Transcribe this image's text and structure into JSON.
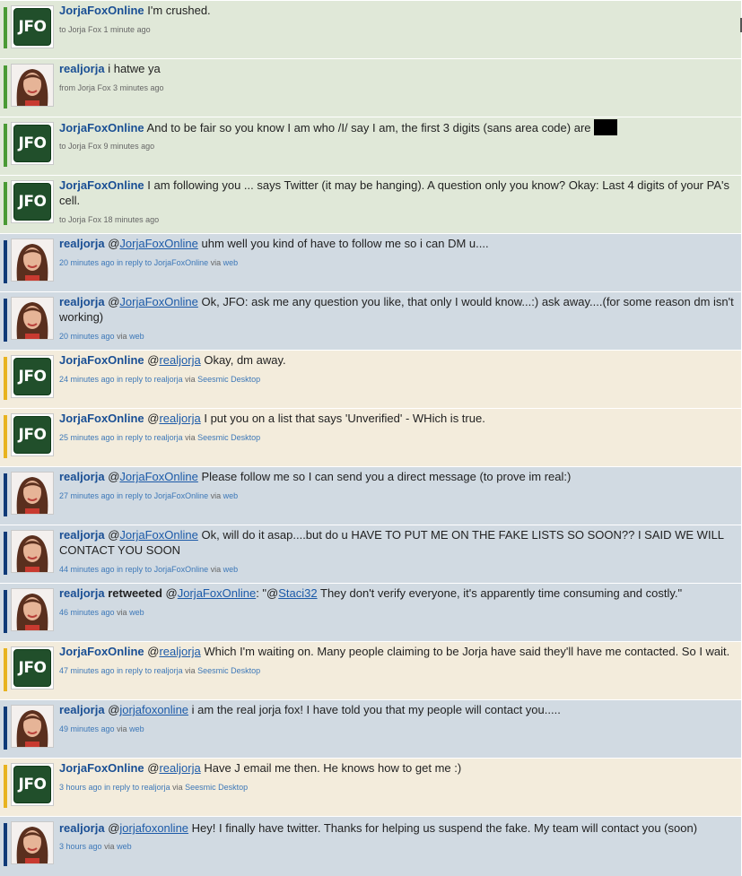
{
  "colors": {
    "green_bg": "#e0e8d8",
    "blue_bg": "#d1dae2",
    "tan_bg": "#f3ecdc",
    "green_bar": "#4a9a35",
    "blue_bar": "#0f3a78",
    "tan_bar": "#e8b31f",
    "username": "#1a4f94",
    "link": "#3d78b8"
  },
  "avatar_labels": {
    "jfo": "JFO"
  },
  "tweets": [
    {
      "user": "JorjaFoxOnline",
      "text": "I'm crushed.",
      "meta": {
        "prefix": "to Jorja Fox",
        "time": "1 minute ago"
      }
    },
    {
      "user": "realjorja",
      "text": "i hatwe ya",
      "meta": {
        "prefix": "from Jorja Fox",
        "time": "3 minutes ago"
      }
    },
    {
      "user": "JorjaFoxOnline",
      "text": "And to be fair so you know I am who /I/ say I am, the first 3 digits (sans area code) are",
      "meta": {
        "prefix": "to Jorja Fox",
        "time": "9 minutes ago"
      }
    },
    {
      "user": "JorjaFoxOnline",
      "text": "I am following you ... says Twitter (it may be hanging). A question only you know? Okay: Last 4 digits of your PA's cell.",
      "meta": {
        "prefix": "to Jorja Fox",
        "time": "18 minutes ago"
      }
    },
    {
      "user": "realjorja",
      "at": "@",
      "mention": "JorjaFoxOnline",
      "text": "uhm well you kind of have to follow me so i can DM u....",
      "meta": {
        "time": "20 minutes ago",
        "reply": "in reply to JorjaFoxOnline",
        "via": "via",
        "source": "web"
      }
    },
    {
      "user": "realjorja",
      "at": "@",
      "mention": "JorjaFoxOnline",
      "text": "Ok, JFO: ask me any question you like, that only I would know...:) ask away....(for some reason dm isn't working)",
      "meta": {
        "time": "20 minutes ago",
        "via": "via",
        "source": "web"
      }
    },
    {
      "user": "JorjaFoxOnline",
      "at": "@",
      "mention": "realjorja",
      "text": "Okay, dm away.",
      "meta": {
        "time": "24 minutes ago",
        "reply": "in reply to realjorja",
        "via": "via",
        "source": "Seesmic Desktop"
      }
    },
    {
      "user": "JorjaFoxOnline",
      "at": "@",
      "mention": "realjorja",
      "text": "I put you on a list that says 'Unverified' - WHich is true.",
      "meta": {
        "time": "25 minutes ago",
        "reply": "in reply to realjorja",
        "via": "via",
        "source": "Seesmic Desktop"
      }
    },
    {
      "user": "realjorja",
      "at": "@",
      "mention": "JorjaFoxOnline",
      "text": "Please follow me so I can send you a direct message (to prove im real:)",
      "meta": {
        "time": "27 minutes ago",
        "reply": "in reply to JorjaFoxOnline",
        "via": "via",
        "source": "web"
      }
    },
    {
      "user": "realjorja",
      "at": "@",
      "mention": "JorjaFoxOnline",
      "text": "Ok, will do it asap....but do u HAVE TO PUT ME ON THE FAKE LISTS SO SOON?? I SAID WE WILL CONTACT YOU SOON",
      "meta": {
        "time": "44 minutes ago",
        "reply": "in reply to JorjaFoxOnline",
        "via": "via",
        "source": "web"
      }
    },
    {
      "user": "realjorja",
      "retweeted": "retweeted",
      "at": "@",
      "mention": "JorjaFoxOnline",
      "rt_pre": ": \"@",
      "rt_mention": "Staci32",
      "text": "They don't verify everyone, it's apparently time consuming and costly.\"",
      "meta": {
        "time": "46 minutes ago",
        "via": "via",
        "source": "web"
      }
    },
    {
      "user": "JorjaFoxOnline",
      "at": "@",
      "mention": "realjorja",
      "text": "Which I'm waiting on. Many people claiming to be Jorja have said they'll have me contacted. So I wait.",
      "meta": {
        "time": "47 minutes ago",
        "reply": "in reply to realjorja",
        "via": "via",
        "source": "Seesmic Desktop"
      }
    },
    {
      "user": "realjorja",
      "at": "@",
      "mention": "jorjafoxonline",
      "text": " i am the real jorja fox! I have told you that my people will contact you.....",
      "meta": {
        "time": "49 minutes ago",
        "via": "via",
        "source": "web"
      }
    },
    {
      "user": "JorjaFoxOnline",
      "at": "@",
      "mention": "realjorja",
      "text": "Have J email me then. He knows how to get me :)",
      "meta": {
        "time": "3 hours ago",
        "reply": "in reply to realjorja",
        "via": "via",
        "source": "Seesmic Desktop"
      }
    },
    {
      "user": "realjorja",
      "at": "@",
      "mention": "jorjafoxonline",
      "text": "Hey! I finally have twitter. Thanks for helping us suspend the fake. My team will contact you (soon)",
      "meta": {
        "time": "3 hours ago",
        "via": "via",
        "source": "web"
      }
    }
  ]
}
